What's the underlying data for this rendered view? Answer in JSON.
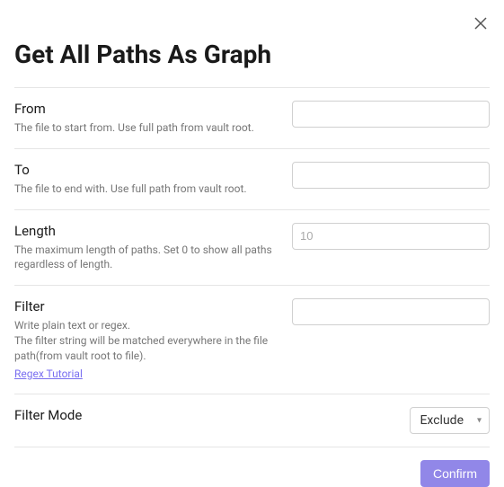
{
  "title": "Get All Paths As Graph",
  "fields": {
    "from": {
      "label": "From",
      "desc": "The file to start from. Use full path from vault root.",
      "value": ""
    },
    "to": {
      "label": "To",
      "desc": "The file to end with. Use full path from vault root.",
      "value": ""
    },
    "length": {
      "label": "Length",
      "desc": "The maximum length of paths. Set 0 to show all paths regardless of length.",
      "placeholder": "10",
      "value": ""
    },
    "filter": {
      "label": "Filter",
      "desc1": "Write plain text or regex.",
      "desc2": "The filter string will be matched everywhere in the file path(from vault root to file).",
      "link": "Regex Tutorial",
      "value": ""
    },
    "filterMode": {
      "label": "Filter Mode",
      "selected": "Exclude"
    }
  },
  "buttons": {
    "confirm": "Confirm"
  }
}
